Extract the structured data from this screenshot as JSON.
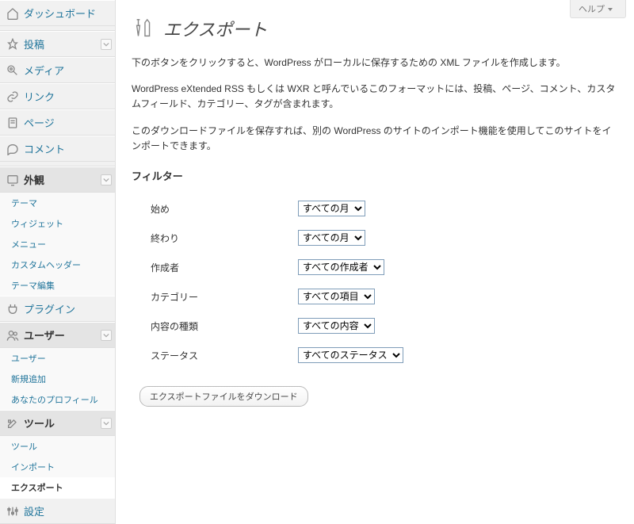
{
  "help": {
    "label": "ヘルプ"
  },
  "sidebar": {
    "dashboard": {
      "label": "ダッシュボード"
    },
    "posts": {
      "label": "投稿"
    },
    "media": {
      "label": "メディア"
    },
    "links": {
      "label": "リンク"
    },
    "pages": {
      "label": "ページ"
    },
    "comments": {
      "label": "コメント"
    },
    "appearance": {
      "label": "外観",
      "items": [
        "テーマ",
        "ウィジェット",
        "メニュー",
        "カスタムヘッダー",
        "テーマ編集"
      ]
    },
    "plugins": {
      "label": "プラグイン"
    },
    "users": {
      "label": "ユーザー",
      "items": [
        "ユーザー",
        "新規追加",
        "あなたのプロフィール"
      ]
    },
    "tools": {
      "label": "ツール",
      "items": [
        "ツール",
        "インポート",
        "エクスポート"
      ]
    },
    "settings": {
      "label": "設定"
    }
  },
  "page": {
    "title": "エクスポート",
    "p1": "下のボタンをクリックすると、WordPress がローカルに保存するための XML ファイルを作成します。",
    "p2": "WordPress eXtended RSS もしくは WXR と呼んでいるこのフォーマットには、投稿、ページ、コメント、カスタムフィールド、カテゴリー、タグが含まれます。",
    "p3": "このダウンロードファイルを保存すれば、別の WordPress のサイトのインポート機能を使用してこのサイトをインポートできます。",
    "filter_title": "フィルター",
    "fields": {
      "start": {
        "label": "始め",
        "value": "すべての月"
      },
      "end": {
        "label": "終わり",
        "value": "すべての月"
      },
      "author": {
        "label": "作成者",
        "value": "すべての作成者"
      },
      "category": {
        "label": "カテゴリー",
        "value": "すべての項目"
      },
      "type": {
        "label": "内容の種類",
        "value": "すべての内容"
      },
      "status": {
        "label": "ステータス",
        "value": "すべてのステータス"
      }
    },
    "submit": "エクスポートファイルをダウンロード"
  }
}
